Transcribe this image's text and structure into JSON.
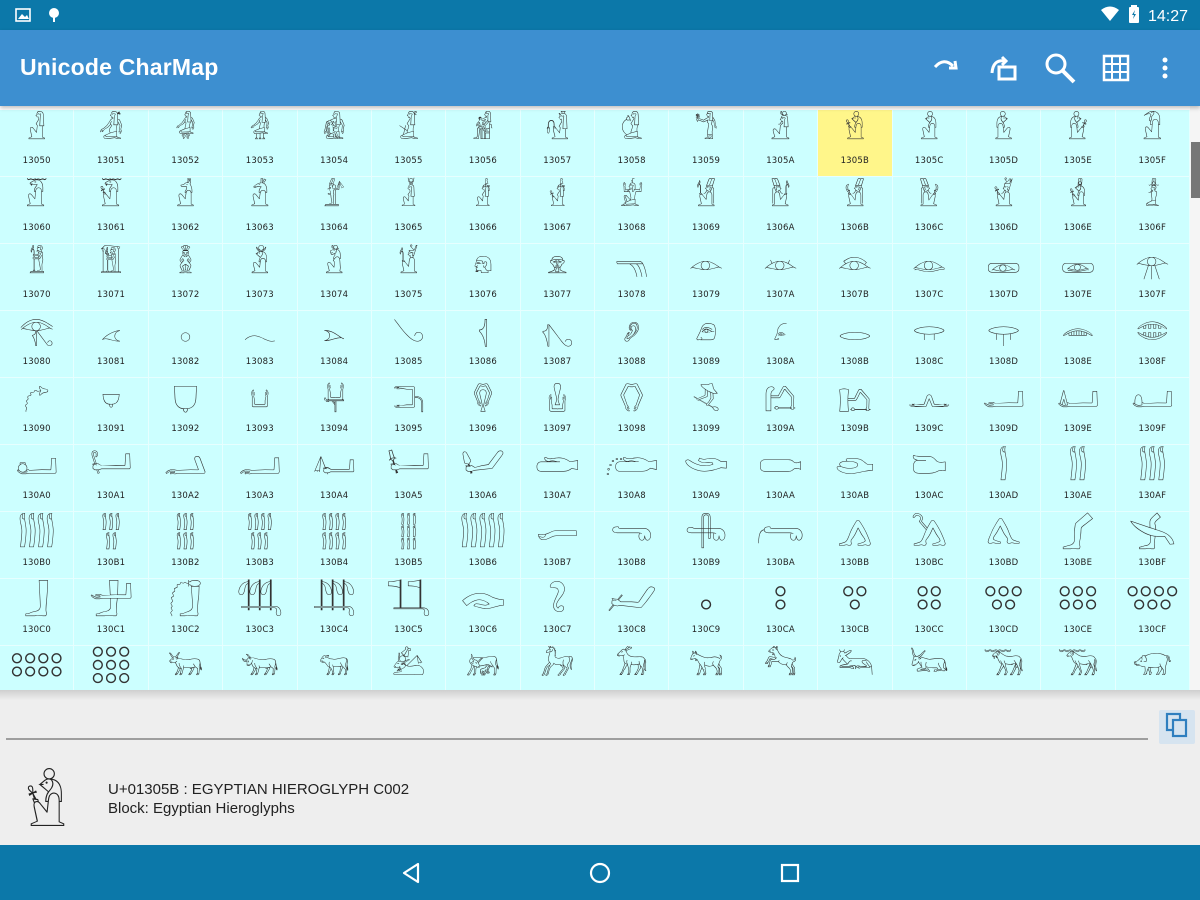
{
  "status_bar": {
    "time": "14:27",
    "icons": [
      "image-icon",
      "location-icon",
      "wifi-icon",
      "battery-icon"
    ]
  },
  "app_bar": {
    "title": "Unicode CharMap",
    "actions": [
      "redo-icon",
      "jump-icon",
      "search-icon",
      "grid-icon",
      "overflow-menu-icon"
    ]
  },
  "grid": {
    "selected": "1305B",
    "cells": [
      {
        "code": "13050",
        "glyph": "𓁐"
      },
      {
        "code": "13051",
        "glyph": "𓁑"
      },
      {
        "code": "13052",
        "glyph": "𓁒"
      },
      {
        "code": "13053",
        "glyph": "𓁓"
      },
      {
        "code": "13054",
        "glyph": "𓁔"
      },
      {
        "code": "13055",
        "glyph": "𓁕"
      },
      {
        "code": "13056",
        "glyph": "𓁖"
      },
      {
        "code": "13057",
        "glyph": "𓁗"
      },
      {
        "code": "13058",
        "glyph": "𓁘"
      },
      {
        "code": "13059",
        "glyph": "𓁙"
      },
      {
        "code": "1305A",
        "glyph": "𓁚"
      },
      {
        "code": "1305B",
        "glyph": "𓁛"
      },
      {
        "code": "1305C",
        "glyph": "𓁜"
      },
      {
        "code": "1305D",
        "glyph": "𓁝"
      },
      {
        "code": "1305E",
        "glyph": "𓁞"
      },
      {
        "code": "1305F",
        "glyph": "𓁟"
      },
      {
        "code": "13060",
        "glyph": "𓁠"
      },
      {
        "code": "13061",
        "glyph": "𓁡"
      },
      {
        "code": "13062",
        "glyph": "𓁢"
      },
      {
        "code": "13063",
        "glyph": "𓁣"
      },
      {
        "code": "13064",
        "glyph": "𓁤"
      },
      {
        "code": "13065",
        "glyph": "𓁥"
      },
      {
        "code": "13066",
        "glyph": "𓁦"
      },
      {
        "code": "13067",
        "glyph": "𓁧"
      },
      {
        "code": "13068",
        "glyph": "𓁨"
      },
      {
        "code": "13069",
        "glyph": "𓁩"
      },
      {
        "code": "1306A",
        "glyph": "𓁪"
      },
      {
        "code": "1306B",
        "glyph": "𓁫"
      },
      {
        "code": "1306C",
        "glyph": "𓁬"
      },
      {
        "code": "1306D",
        "glyph": "𓁭"
      },
      {
        "code": "1306E",
        "glyph": "𓁮"
      },
      {
        "code": "1306F",
        "glyph": "𓁯"
      },
      {
        "code": "13070",
        "glyph": "𓁰"
      },
      {
        "code": "13071",
        "glyph": "𓁱"
      },
      {
        "code": "13072",
        "glyph": "𓁲"
      },
      {
        "code": "13073",
        "glyph": "𓁳"
      },
      {
        "code": "13074",
        "glyph": "𓁴"
      },
      {
        "code": "13075",
        "glyph": "𓁵"
      },
      {
        "code": "13076",
        "glyph": "𓁶"
      },
      {
        "code": "13077",
        "glyph": "𓁷"
      },
      {
        "code": "13078",
        "glyph": "𓁸"
      },
      {
        "code": "13079",
        "glyph": "𓁹"
      },
      {
        "code": "1307A",
        "glyph": "𓁺"
      },
      {
        "code": "1307B",
        "glyph": "𓁻"
      },
      {
        "code": "1307C",
        "glyph": "𓁼"
      },
      {
        "code": "1307D",
        "glyph": "𓁽"
      },
      {
        "code": "1307E",
        "glyph": "𓁾"
      },
      {
        "code": "1307F",
        "glyph": "𓁿"
      },
      {
        "code": "13080",
        "glyph": "𓂀"
      },
      {
        "code": "13081",
        "glyph": "𓂁"
      },
      {
        "code": "13082",
        "glyph": "𓂂"
      },
      {
        "code": "13083",
        "glyph": "𓂃"
      },
      {
        "code": "13084",
        "glyph": "𓂄"
      },
      {
        "code": "13085",
        "glyph": "𓂅"
      },
      {
        "code": "13086",
        "glyph": "𓂆"
      },
      {
        "code": "13087",
        "glyph": "𓂇"
      },
      {
        "code": "13088",
        "glyph": "𓂈"
      },
      {
        "code": "13089",
        "glyph": "𓂉"
      },
      {
        "code": "1308A",
        "glyph": "𓂊"
      },
      {
        "code": "1308B",
        "glyph": "𓂋"
      },
      {
        "code": "1308C",
        "glyph": "𓂌"
      },
      {
        "code": "1308D",
        "glyph": "𓂍"
      },
      {
        "code": "1308E",
        "glyph": "𓂎"
      },
      {
        "code": "1308F",
        "glyph": "𓂏"
      },
      {
        "code": "13090",
        "glyph": "𓂐"
      },
      {
        "code": "13091",
        "glyph": "𓂑"
      },
      {
        "code": "13092",
        "glyph": "𓂒"
      },
      {
        "code": "13093",
        "glyph": "𓂓"
      },
      {
        "code": "13094",
        "glyph": "𓂔"
      },
      {
        "code": "13095",
        "glyph": "𓂕"
      },
      {
        "code": "13096",
        "glyph": "𓂖"
      },
      {
        "code": "13097",
        "glyph": "𓂗"
      },
      {
        "code": "13098",
        "glyph": "𓂘"
      },
      {
        "code": "13099",
        "glyph": "𓂙"
      },
      {
        "code": "1309A",
        "glyph": "𓂚"
      },
      {
        "code": "1309B",
        "glyph": "𓂛"
      },
      {
        "code": "1309C",
        "glyph": "𓂜"
      },
      {
        "code": "1309D",
        "glyph": "𓂝"
      },
      {
        "code": "1309E",
        "glyph": "𓂞"
      },
      {
        "code": "1309F",
        "glyph": "𓂟"
      },
      {
        "code": "130A0",
        "glyph": "𓂠"
      },
      {
        "code": "130A1",
        "glyph": "𓂡"
      },
      {
        "code": "130A2",
        "glyph": "𓂢"
      },
      {
        "code": "130A3",
        "glyph": "𓂣"
      },
      {
        "code": "130A4",
        "glyph": "𓂤"
      },
      {
        "code": "130A5",
        "glyph": "𓂥"
      },
      {
        "code": "130A6",
        "glyph": "𓂦"
      },
      {
        "code": "130A7",
        "glyph": "𓂧"
      },
      {
        "code": "130A8",
        "glyph": "𓂨"
      },
      {
        "code": "130A9",
        "glyph": "𓂩"
      },
      {
        "code": "130AA",
        "glyph": "𓂪"
      },
      {
        "code": "130AB",
        "glyph": "𓂫"
      },
      {
        "code": "130AC",
        "glyph": "𓂬"
      },
      {
        "code": "130AD",
        "glyph": "𓂭"
      },
      {
        "code": "130AE",
        "glyph": "𓂮"
      },
      {
        "code": "130AF",
        "glyph": "𓂯"
      },
      {
        "code": "130B0",
        "glyph": "𓂰"
      },
      {
        "code": "130B1",
        "glyph": "𓂱"
      },
      {
        "code": "130B2",
        "glyph": "𓂲"
      },
      {
        "code": "130B3",
        "glyph": "𓂳"
      },
      {
        "code": "130B4",
        "glyph": "𓂴"
      },
      {
        "code": "130B5",
        "glyph": "𓂵"
      },
      {
        "code": "130B6",
        "glyph": "𓂶"
      },
      {
        "code": "130B7",
        "glyph": "𓂷"
      },
      {
        "code": "130B8",
        "glyph": "𓂸"
      },
      {
        "code": "130B9",
        "glyph": "𓂹"
      },
      {
        "code": "130BA",
        "glyph": "𓂺"
      },
      {
        "code": "130BB",
        "glyph": "𓂻"
      },
      {
        "code": "130BC",
        "glyph": "𓂼"
      },
      {
        "code": "130BD",
        "glyph": "𓂽"
      },
      {
        "code": "130BE",
        "glyph": "𓂾"
      },
      {
        "code": "130BF",
        "glyph": "𓂿"
      },
      {
        "code": "130C0",
        "glyph": "𓃀"
      },
      {
        "code": "130C1",
        "glyph": "𓃁"
      },
      {
        "code": "130C2",
        "glyph": "𓃂"
      },
      {
        "code": "130C3",
        "glyph": "𓃃"
      },
      {
        "code": "130C4",
        "glyph": "𓃄"
      },
      {
        "code": "130C5",
        "glyph": "𓃅"
      },
      {
        "code": "130C6",
        "glyph": "𓃆"
      },
      {
        "code": "130C7",
        "glyph": "𓃇"
      },
      {
        "code": "130C8",
        "glyph": "𓃈"
      },
      {
        "code": "130C9",
        "glyph": "𓃉"
      },
      {
        "code": "130CA",
        "glyph": "𓃊"
      },
      {
        "code": "130CB",
        "glyph": "𓃋"
      },
      {
        "code": "130CC",
        "glyph": "𓃌"
      },
      {
        "code": "130CD",
        "glyph": "𓃍"
      },
      {
        "code": "130CE",
        "glyph": "𓃎"
      },
      {
        "code": "130CF",
        "glyph": "𓃏"
      },
      {
        "code": "",
        "glyph": "𓃐"
      },
      {
        "code": "",
        "glyph": "𓃑"
      },
      {
        "code": "",
        "glyph": "𓃒"
      },
      {
        "code": "",
        "glyph": "𓃓"
      },
      {
        "code": "",
        "glyph": "𓃔"
      },
      {
        "code": "",
        "glyph": "𓃕"
      },
      {
        "code": "",
        "glyph": "𓃖"
      },
      {
        "code": "",
        "glyph": "𓃗"
      },
      {
        "code": "",
        "glyph": "𓃘"
      },
      {
        "code": "",
        "glyph": "𓃙"
      },
      {
        "code": "",
        "glyph": "𓃚"
      },
      {
        "code": "",
        "glyph": "𓃛"
      },
      {
        "code": "",
        "glyph": "𓃜"
      },
      {
        "code": "",
        "glyph": "𓃝"
      },
      {
        "code": "",
        "glyph": "𓃞"
      },
      {
        "code": "",
        "glyph": "𓃟"
      }
    ]
  },
  "input": {
    "value": "",
    "copy_icon": "copy-icon"
  },
  "details": {
    "glyph": "𓁛",
    "name_line": "U+01305B : EGYPTIAN HIEROGLYPH C002",
    "block_line": "Block: Egyptian Hieroglyphs"
  },
  "nav_bar": {
    "buttons": [
      "back-icon",
      "home-icon",
      "recents-icon"
    ]
  },
  "colors": {
    "status_bar": "#0c78a9",
    "app_bar": "#3d8fd0",
    "cell_bg": "#ccffff",
    "selected_cell": "#fff68a"
  }
}
